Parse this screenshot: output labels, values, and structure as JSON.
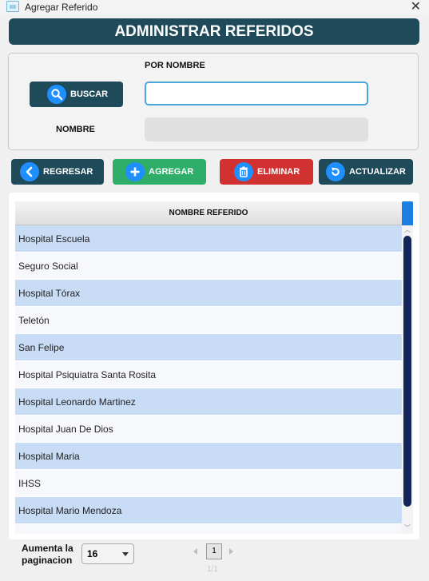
{
  "window": {
    "title": "Agregar Referido"
  },
  "header": {
    "title": "ADMINISTRAR REFERIDOS"
  },
  "search": {
    "by_name_label": "POR NOMBRE",
    "search_button": "BUSCAR",
    "input_value": "",
    "name_label": "NOMBRE",
    "name_value": ""
  },
  "actions": {
    "back": "REGRESAR",
    "add": "AGREGAR",
    "delete": "ELIMINAR",
    "refresh": "ACTUALIZAR"
  },
  "table": {
    "column_header": "NOMBRE REFERIDO",
    "rows": [
      "Hospital Escuela",
      "Seguro Social",
      "Hospital Tórax",
      "Teletón",
      "San Felipe",
      "Hospital Psiquiatra Santa Rosita",
      "Hospital Leonardo Martinez",
      "Hospital Juan De Dios",
      "Hospital Maria",
      "IHSS",
      "Hospital Mario Mendoza"
    ]
  },
  "footer": {
    "page_size_label": "Aumenta la paginacion",
    "page_size_value": "16",
    "current_page": "1",
    "page_count": "1/1"
  },
  "colors": {
    "header": "#1e4a59",
    "add": "#2fae6a",
    "delete": "#d13131",
    "icon_blue": "#1f8fff",
    "row_highlight": "#c8dcf6",
    "scroll_thumb": "#142559"
  },
  "icons": [
    "app-icon",
    "close-icon",
    "search-icon",
    "chevron-left-icon",
    "plus-icon",
    "trash-icon",
    "refresh-icon",
    "caret-down-icon"
  ]
}
